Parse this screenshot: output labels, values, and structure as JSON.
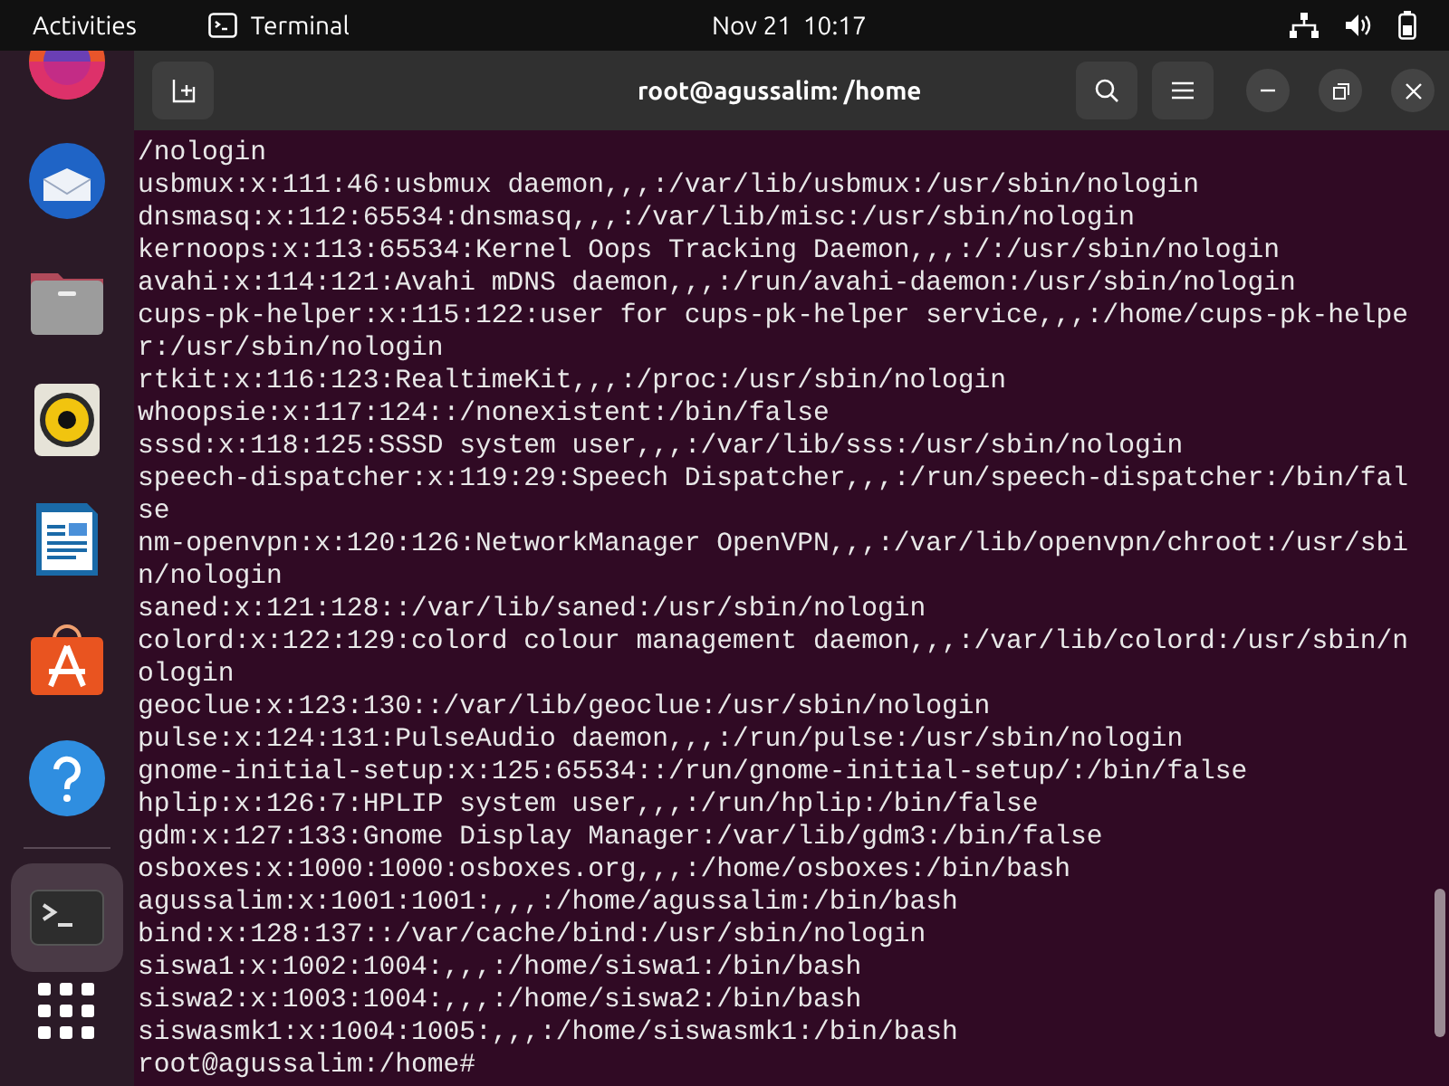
{
  "top_bar": {
    "activities": "Activities",
    "app_name": "Terminal",
    "clock": "Nov 21  10:17"
  },
  "window": {
    "title": "root@agussalim: /home"
  },
  "terminal": {
    "lines": [
      "/nologin",
      "usbmux:x:111:46:usbmux daemon,,,:/var/lib/usbmux:/usr/sbin/nologin",
      "dnsmasq:x:112:65534:dnsmasq,,,:/var/lib/misc:/usr/sbin/nologin",
      "kernoops:x:113:65534:Kernel Oops Tracking Daemon,,,:/:/usr/sbin/nologin",
      "avahi:x:114:121:Avahi mDNS daemon,,,:/run/avahi-daemon:/usr/sbin/nologin",
      "cups-pk-helper:x:115:122:user for cups-pk-helper service,,,:/home/cups-pk-helpe",
      "r:/usr/sbin/nologin",
      "rtkit:x:116:123:RealtimeKit,,,:/proc:/usr/sbin/nologin",
      "whoopsie:x:117:124::/nonexistent:/bin/false",
      "sssd:x:118:125:SSSD system user,,,:/var/lib/sss:/usr/sbin/nologin",
      "speech-dispatcher:x:119:29:Speech Dispatcher,,,:/run/speech-dispatcher:/bin/fal",
      "se",
      "nm-openvpn:x:120:126:NetworkManager OpenVPN,,,:/var/lib/openvpn/chroot:/usr/sbi",
      "n/nologin",
      "saned:x:121:128::/var/lib/saned:/usr/sbin/nologin",
      "colord:x:122:129:colord colour management daemon,,,:/var/lib/colord:/usr/sbin/n",
      "ologin",
      "geoclue:x:123:130::/var/lib/geoclue:/usr/sbin/nologin",
      "pulse:x:124:131:PulseAudio daemon,,,:/run/pulse:/usr/sbin/nologin",
      "gnome-initial-setup:x:125:65534::/run/gnome-initial-setup/:/bin/false",
      "hplip:x:126:7:HPLIP system user,,,:/run/hplip:/bin/false",
      "gdm:x:127:133:Gnome Display Manager:/var/lib/gdm3:/bin/false",
      "osboxes:x:1000:1000:osboxes.org,,,:/home/osboxes:/bin/bash",
      "agussalim:x:1001:1001:,,,:/home/agussalim:/bin/bash",
      "bind:x:128:137::/var/cache/bind:/usr/sbin/nologin",
      "siswa1:x:1002:1004:,,,:/home/siswa1:/bin/bash",
      "siswa2:x:1003:1004:,,,:/home/siswa2:/bin/bash",
      "siswasmk1:x:1004:1005:,,,:/home/siswasmk1:/bin/bash"
    ],
    "prompt": "root@agussalim:/home#"
  }
}
